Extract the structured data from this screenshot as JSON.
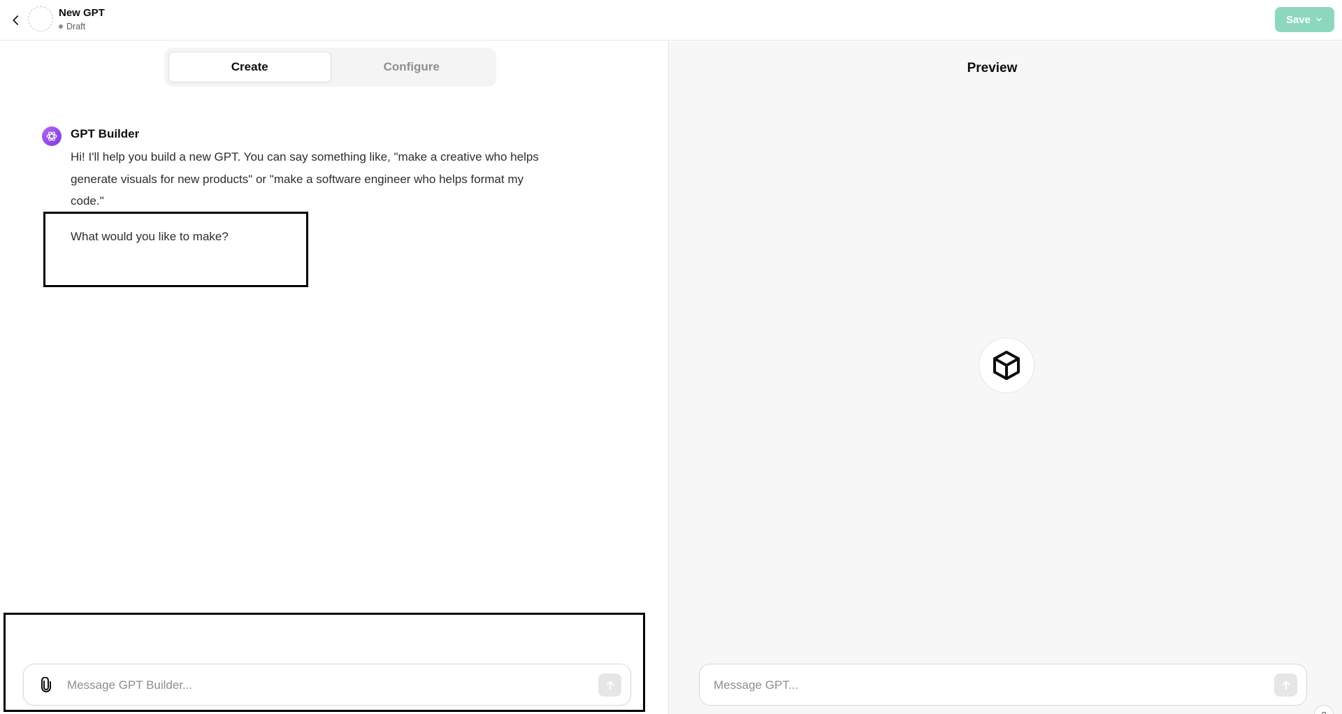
{
  "header": {
    "gpt_name": "New GPT",
    "status": "Draft",
    "save_label": "Save",
    "back_icon": "chevron-left-icon",
    "save_dropdown_icon": "chevron-down-icon"
  },
  "tabs": [
    {
      "label": "Create",
      "active": true
    },
    {
      "label": "Configure",
      "active": false
    }
  ],
  "conversation": {
    "author": "GPT Builder",
    "message": "Hi! I'll help you build a new GPT. You can say something like, \"make a creative who helps generate visuals for new products\" or \"make a software engineer who helps format my code.\"",
    "question": "What would you like to make?"
  },
  "builder_input": {
    "placeholder": "Message GPT Builder...",
    "value": ""
  },
  "preview": {
    "title": "Preview",
    "placeholder": "Message GPT...",
    "icon": "cube-icon",
    "help_label": "?"
  },
  "colors": {
    "save_button": "#8dd7be",
    "builder_icon": "#a855f7",
    "preview_background": "#f7f7f7"
  }
}
